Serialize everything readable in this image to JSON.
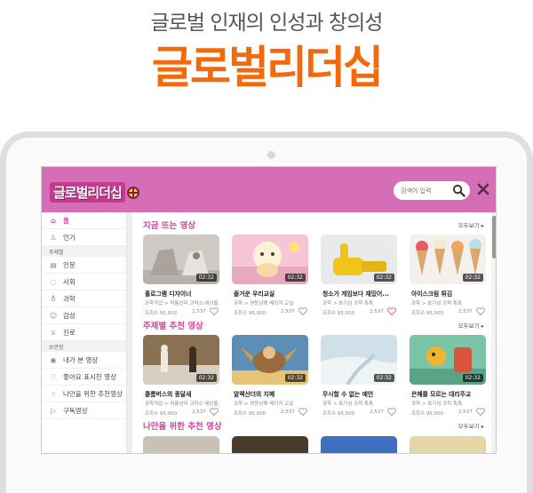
{
  "hero": {
    "subtitle": "글로벌 인재의 인성과 창의성",
    "title": "글로벌리더십"
  },
  "app": {
    "logo_text": "글로벌리더십",
    "search_placeholder": "검색어 입력",
    "accent": "#d56eb6",
    "highlight": "#d0489c"
  },
  "sidebar": {
    "items": [
      {
        "label": "홈",
        "icon": "home-icon",
        "active": true
      },
      {
        "label": "인기",
        "icon": "thumbs-up-icon"
      }
    ],
    "section_topic": "주제별",
    "topics": [
      {
        "label": "인문",
        "icon": "book-icon"
      },
      {
        "label": "사회",
        "icon": "speech-bubble-icon"
      },
      {
        "label": "과학",
        "icon": "flask-icon"
      },
      {
        "label": "감성",
        "icon": "smile-icon"
      },
      {
        "label": "진로",
        "icon": "graduation-cap-icon"
      }
    ],
    "section_saved": "보관함",
    "saved": [
      {
        "label": "내가 본 영상",
        "icon": "eye-icon"
      },
      {
        "label": "좋아요 표시한 영상",
        "icon": "heart-icon"
      },
      {
        "label": "나만을 위한 추천영상",
        "icon": "hand-pointer-icon"
      },
      {
        "label": "구독영상",
        "icon": "play-box-icon"
      }
    ]
  },
  "sections": [
    {
      "title": "지금 뜨는 영상",
      "more": "모두보기 ▸",
      "cards": [
        {
          "title": "홀로그램 디자이너",
          "category": "과학직업 > 허롱선미 과학소·세상을...",
          "views": "조회수 95,000",
          "likes": "2,537",
          "duration": "02:32",
          "liked": false
        },
        {
          "title": "즐거운 우리교실",
          "category": "과학 > 영등남해 메이저 교실",
          "views": "조회수 95,000",
          "likes": "2,537",
          "duration": "02:32",
          "liked": false
        },
        {
          "title": "청소가 게임보다 재밌어...",
          "category": "과학 > 호기심 과학 톡톡",
          "views": "조회수 95,000",
          "likes": "2,537",
          "duration": "02:32",
          "liked": true
        },
        {
          "title": "아이스크림 튀김",
          "category": "과학 > 호기심 과학 톡톡",
          "views": "조회수 95,000",
          "likes": "2,537",
          "duration": "02:32",
          "liked": false
        }
      ]
    },
    {
      "title": "주제별 추천 영상",
      "more": "모두보기 ▸",
      "cards": [
        {
          "title": "콜롬버스의 종달새",
          "category": "과학직업 > 허롱선미 과학소·세상을...",
          "views": "조회수 95,000",
          "likes": "2,537",
          "duration": "02:32",
          "liked": false
        },
        {
          "title": "알렉산더의 지혜",
          "category": "과학 > 영등남해 메이저 교실",
          "views": "조회수 95,000",
          "likes": "2,537",
          "duration": "02:32",
          "liked": false
        },
        {
          "title": "무시할 수 없는 예언",
          "category": "과학 > 호기심 과학 톡톡",
          "views": "조회수 95,000",
          "likes": "2,537",
          "duration": "02:32",
          "liked": false
        },
        {
          "title": "은혜를 모르는 대리주교",
          "category": "과학 > 호기심 과학 톡톡",
          "views": "조회수 95,000",
          "likes": "2,537",
          "duration": "02:32",
          "liked": false
        }
      ]
    },
    {
      "title": "나만을 위한 추천 영상",
      "more": "모두보기 ▸"
    }
  ]
}
